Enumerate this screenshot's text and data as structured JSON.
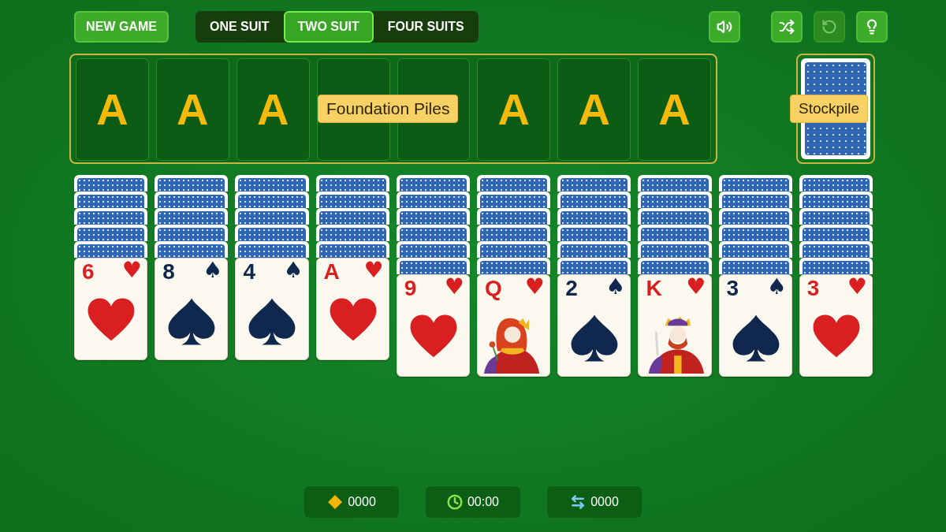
{
  "toolbar": {
    "new_game": "NEW GAME",
    "modes": [
      {
        "label": "ONE SUIT",
        "selected": false
      },
      {
        "label": "TWO SUIT",
        "selected": true
      },
      {
        "label": "FOUR SUITS",
        "selected": false
      }
    ],
    "actions": [
      {
        "kind": "sound",
        "disabled": false
      },
      {
        "kind": "shuffle",
        "disabled": false
      },
      {
        "kind": "undo",
        "disabled": true
      },
      {
        "kind": "hint",
        "disabled": false
      }
    ]
  },
  "foundation": {
    "label": "Foundation Piles",
    "slots_left": [
      "A",
      "A",
      "A"
    ],
    "slots_right": [
      "A",
      "A",
      "A"
    ]
  },
  "stockpile": {
    "label": "Stockpile"
  },
  "tableau": [
    {
      "cards": [
        {
          "face_up": false
        },
        {
          "face_up": false
        },
        {
          "face_up": false
        },
        {
          "face_up": false
        },
        {
          "face_up": false
        },
        {
          "face_up": true,
          "rank": "6",
          "suit": "♥",
          "color": "#d91f1f",
          "kind": "heart"
        }
      ]
    },
    {
      "cards": [
        {
          "face_up": false
        },
        {
          "face_up": false
        },
        {
          "face_up": false
        },
        {
          "face_up": false
        },
        {
          "face_up": false
        },
        {
          "face_up": true,
          "rank": "8",
          "suit": "♠",
          "color": "#10284d",
          "kind": "spade"
        }
      ]
    },
    {
      "cards": [
        {
          "face_up": false
        },
        {
          "face_up": false
        },
        {
          "face_up": false
        },
        {
          "face_up": false
        },
        {
          "face_up": false
        },
        {
          "face_up": true,
          "rank": "4",
          "suit": "♠",
          "color": "#10284d",
          "kind": "spade"
        }
      ]
    },
    {
      "cards": [
        {
          "face_up": false
        },
        {
          "face_up": false
        },
        {
          "face_up": false
        },
        {
          "face_up": false
        },
        {
          "face_up": false
        },
        {
          "face_up": true,
          "rank": "A",
          "suit": "♥",
          "color": "#d91f1f",
          "kind": "heart"
        }
      ]
    },
    {
      "cards": [
        {
          "face_up": false
        },
        {
          "face_up": false
        },
        {
          "face_up": false
        },
        {
          "face_up": false
        },
        {
          "face_up": false
        },
        {
          "face_up": false
        },
        {
          "face_up": true,
          "rank": "9",
          "suit": "♥",
          "color": "#d91f1f",
          "kind": "heart"
        }
      ]
    },
    {
      "cards": [
        {
          "face_up": false
        },
        {
          "face_up": false
        },
        {
          "face_up": false
        },
        {
          "face_up": false
        },
        {
          "face_up": false
        },
        {
          "face_up": false
        },
        {
          "face_up": true,
          "rank": "Q",
          "suit": "♥",
          "color": "#d91f1f",
          "kind": "queen"
        }
      ]
    },
    {
      "cards": [
        {
          "face_up": false
        },
        {
          "face_up": false
        },
        {
          "face_up": false
        },
        {
          "face_up": false
        },
        {
          "face_up": false
        },
        {
          "face_up": false
        },
        {
          "face_up": true,
          "rank": "2",
          "suit": "♠",
          "color": "#10284d",
          "kind": "spade"
        }
      ]
    },
    {
      "cards": [
        {
          "face_up": false
        },
        {
          "face_up": false
        },
        {
          "face_up": false
        },
        {
          "face_up": false
        },
        {
          "face_up": false
        },
        {
          "face_up": false
        },
        {
          "face_up": true,
          "rank": "K",
          "suit": "♥",
          "color": "#d91f1f",
          "kind": "king"
        }
      ]
    },
    {
      "cards": [
        {
          "face_up": false
        },
        {
          "face_up": false
        },
        {
          "face_up": false
        },
        {
          "face_up": false
        },
        {
          "face_up": false
        },
        {
          "face_up": false
        },
        {
          "face_up": true,
          "rank": "3",
          "suit": "♠",
          "color": "#10284d",
          "kind": "spade"
        }
      ]
    },
    {
      "cards": [
        {
          "face_up": false
        },
        {
          "face_up": false
        },
        {
          "face_up": false
        },
        {
          "face_up": false
        },
        {
          "face_up": false
        },
        {
          "face_up": false
        },
        {
          "face_up": true,
          "rank": "3",
          "suit": "♥",
          "color": "#d91f1f",
          "kind": "heart"
        }
      ]
    }
  ],
  "stats": [
    {
      "kind": "score",
      "value": "0000"
    },
    {
      "kind": "time",
      "value": "00:00"
    },
    {
      "kind": "moves",
      "value": "0000"
    }
  ]
}
